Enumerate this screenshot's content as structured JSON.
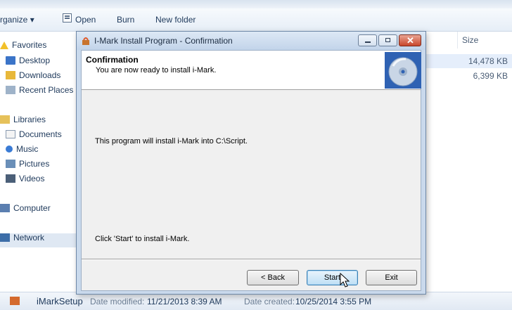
{
  "explorer": {
    "toolbar": {
      "organize": "rganize ▾",
      "open": "Open",
      "burn": "Burn",
      "new_folder": "New folder"
    },
    "nav": {
      "favorites": "Favorites",
      "desktop": "Desktop",
      "downloads": "Downloads",
      "recent_places": "Recent Places",
      "libraries": "Libraries",
      "documents": "Documents",
      "music": "Music",
      "pictures": "Pictures",
      "videos": "Videos",
      "computer": "Computer",
      "network": "Network"
    },
    "columns": {
      "size": "Size"
    },
    "file_sizes": [
      "14,478 KB",
      "6,399 KB"
    ],
    "status": {
      "file_name": "iMarkSetup",
      "date_modified_label": "Date modified:",
      "date_modified": "11/21/2013 8:39 AM",
      "date_created_label": "Date created:",
      "date_created": "10/25/2014 3:55 PM"
    }
  },
  "dialog": {
    "title": "I-Mark Install Program - Confirmation",
    "header_title": "Confirmation",
    "header_subtitle": "You are now ready to install i-Mark.",
    "message": "This program will install i-Mark into C:\\Script.",
    "instruction": "Click 'Start' to install i-Mark.",
    "buttons": {
      "back": "< Back",
      "start": "Start",
      "exit": "Exit"
    }
  },
  "icons": {
    "titlebar_icon": "installer-icon",
    "header_image": "cd-disc-icon",
    "cursor": "mouse-pointer-icon"
  },
  "colors": {
    "dialog_frame": "#c9d9ec",
    "close_button": "#c9462c",
    "start_button_border": "#3c7fb1"
  }
}
